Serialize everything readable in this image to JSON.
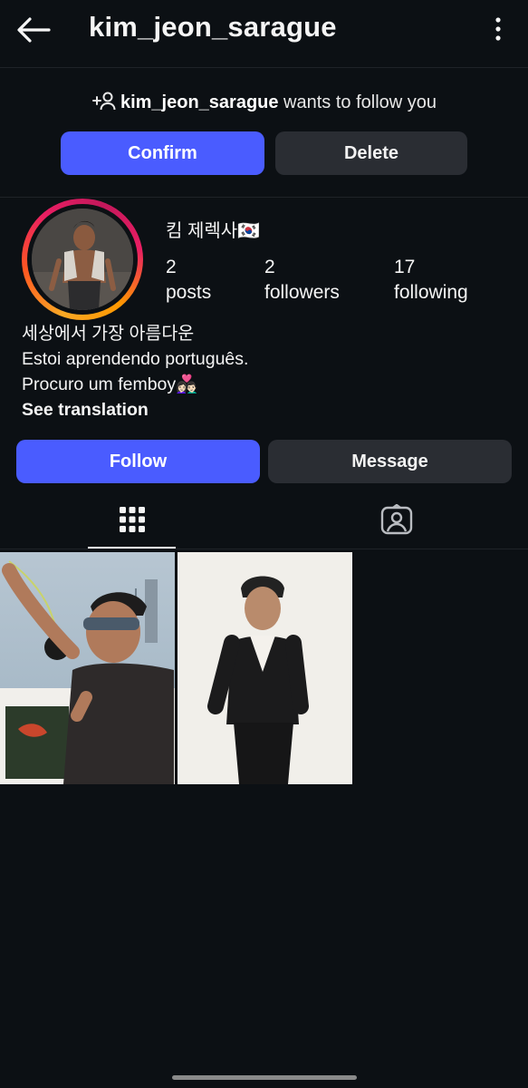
{
  "header": {
    "username": "kim_jeon_sarague"
  },
  "follow_request": {
    "username": "kim_jeon_sarague",
    "suffix": " wants to follow you",
    "confirm_label": "Confirm",
    "delete_label": "Delete"
  },
  "profile": {
    "display_name": "킴 제렉사🇰🇷",
    "stats": [
      {
        "value": "2",
        "label": "posts"
      },
      {
        "value": "2",
        "label": "followers"
      },
      {
        "value": "17",
        "label": "following"
      }
    ],
    "bio": [
      "세상에서 가장 아름다운",
      "Estoi aprendendo português.",
      "Procuro um femboy👩🏻‍❤️‍👨🏻"
    ],
    "see_translation": "See translation"
  },
  "actions": {
    "follow_label": "Follow",
    "message_label": "Message"
  },
  "tabs": [
    {
      "icon": "grid-icon",
      "active": true
    },
    {
      "icon": "tagged-icon",
      "active": false
    }
  ],
  "colors": {
    "background": "#0c1014",
    "accent": "#4a5cff",
    "secondary_button": "#2a2d33"
  }
}
